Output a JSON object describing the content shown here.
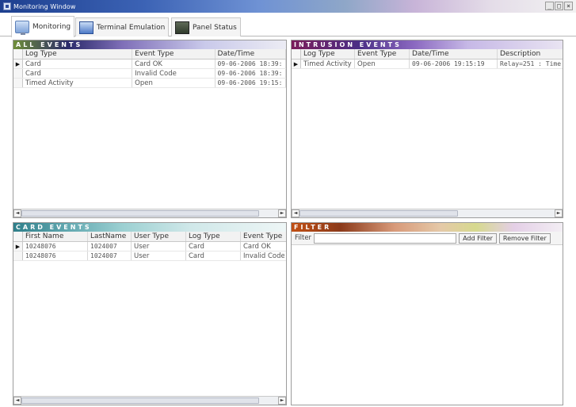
{
  "window": {
    "title": "Monitoring Window",
    "controls": {
      "minimize": "_",
      "maximize": "□",
      "close": "×"
    }
  },
  "tabs": [
    {
      "label": "Monitoring",
      "icon": "monitor-icon",
      "active": true
    },
    {
      "label": "Terminal Emulation",
      "icon": "terminal-icon",
      "active": false
    },
    {
      "label": "Panel Status",
      "icon": "panel-icon",
      "active": false
    }
  ],
  "all_events": {
    "title": "ALL EVENTS",
    "columns": [
      "Log Type",
      "Event Type",
      "Date/Time"
    ],
    "rows": [
      [
        "Card",
        "Card OK",
        "09-06-2006 18:39:"
      ],
      [
        "Card",
        "Invalid Code",
        "09-06-2006 18:39:"
      ],
      [
        "Timed Activity",
        "Open",
        "09-06-2006 19:15:"
      ]
    ],
    "selected_row": 0
  },
  "intrusion_events": {
    "title": "INTRUSION EVENTS",
    "columns": [
      "Log Type",
      "Event Type",
      "Date/Time",
      "Description"
    ],
    "rows": [
      [
        "Timed Activity",
        "Open",
        "09-06-2006 19:15:19",
        "Relay=251 : Time"
      ]
    ],
    "selected_row": 0
  },
  "card_events": {
    "title": "CARD EVENTS",
    "columns": [
      "First Name",
      "LastName",
      "User Type",
      "Log Type",
      "Event Type"
    ],
    "rows": [
      [
        "10248076",
        "1024007",
        "User",
        "Card",
        "Card OK"
      ],
      [
        "10248076",
        "1024007",
        "User",
        "Card",
        "Invalid Code"
      ]
    ],
    "selected_row": 0
  },
  "filter": {
    "title": "FILTER",
    "label": "Filter",
    "input_value": "",
    "add_button": "Add Filter",
    "remove_button": "Remove Filter"
  },
  "scroll": {
    "left_arrow": "◄",
    "right_arrow": "►"
  },
  "row_marker": "▶",
  "colors": {
    "title_bar": "#1d3f8f",
    "all_events_header": "#2a2a6a",
    "intrusion_header": "#7a1e5b",
    "card_header": "#2f7f8a",
    "filter_header": "#c14f14"
  }
}
